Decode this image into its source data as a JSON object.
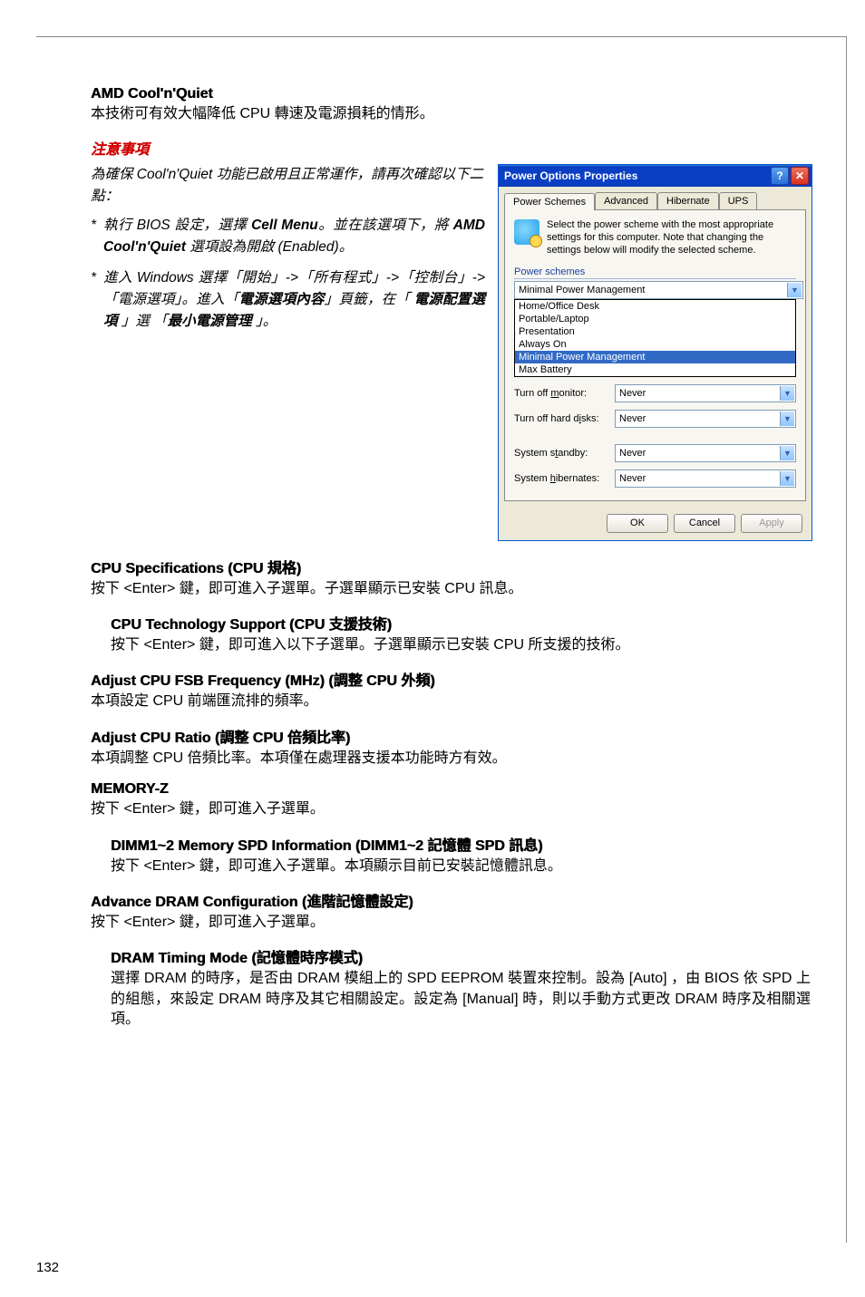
{
  "page_number": "132",
  "section_amd": {
    "title": "AMD Cool'n'Quiet",
    "body": "本技術可有效大幅降低 CPU 轉速及電源損耗的情形。"
  },
  "important": {
    "title": "注意事項",
    "intro": "為確保 Cool'n'Quiet 功能已啟用且正常運作，請再次確認以下二點：",
    "items": [
      {
        "pre": "執行 BIOS 設定，選擇 ",
        "em1": "Cell Menu",
        "mid1": "。並在該選項下，將 ",
        "em2": "AMD Cool'n'Quiet",
        "mid2": " 選項設為開啟 (Enabled)。"
      },
      {
        "pre": "進入  Windows  選擇「開始」->「所有程式」->「控制台」->「電源選項」。進入「",
        "em1": "電源選項內容",
        "mid1": "」頁籤，在「 ",
        "em2": "電源配置選項",
        "mid2": " 」選 「",
        "em3": "最小電源管理",
        "mid3": " 」。"
      }
    ]
  },
  "dialog": {
    "title": "Power Options Properties",
    "tabs": {
      "power_schemes": "Power Schemes",
      "advanced": "Advanced",
      "hibernate": "Hibernate",
      "ups": "UPS"
    },
    "info_text": "Select the power scheme with the most appropriate settings for this computer. Note that changing the settings below will modify the selected scheme.",
    "group_power_schemes": "Power schemes",
    "scheme_selected": "Minimal Power Management",
    "scheme_options": {
      "home_office": "Home/Office Desk",
      "portable": "Portable/Laptop",
      "presentation": "Presentation",
      "always_on": "Always On",
      "minimal": "Minimal Power Management",
      "max_battery": "Max Battery"
    },
    "settings": {
      "turn_off_monitor": {
        "label_pre": "Turn off ",
        "label_u": "m",
        "label_post": "onitor:",
        "value": "Never"
      },
      "turn_off_hard_disks": {
        "label_pre": "Turn off hard d",
        "label_u": "i",
        "label_post": "sks:",
        "value": "Never"
      },
      "system_standby": {
        "label_pre": "System s",
        "label_u": "t",
        "label_post": "andby:",
        "value": "Never"
      },
      "system_hibernates": {
        "label_pre": "System ",
        "label_u": "h",
        "label_post": "ibernates:",
        "value": "Never"
      }
    },
    "buttons": {
      "ok": "OK",
      "cancel": "Cancel",
      "apply": "Apply"
    }
  },
  "cpu_spec": {
    "title": "CPU Specifications (CPU 規格)",
    "body": "按下 <Enter> 鍵，即可進入子選單。子選單顯示已安裝 CPU 訊息。"
  },
  "cpu_tech": {
    "title": "CPU Technology Support (CPU 支援技術)",
    "body": "按下 <Enter> 鍵，即可進入以下子選單。子選單顯示已安裝 CPU 所支援的技術。"
  },
  "fsb": {
    "title": "Adjust CPU FSB Frequency (MHz) (調整 CPU 外頻)",
    "body": "本項設定 CPU 前端匯流排的頻率。"
  },
  "ratio": {
    "title": "Adjust CPU Ratio  (調整 CPU 倍頻比率)",
    "body": "本項調整 CPU 倍頻比率。本項僅在處理器支援本功能時方有效。"
  },
  "memz": {
    "title": "MEMORY-Z",
    "body": "按下 <Enter> 鍵，即可進入子選單。"
  },
  "dimm": {
    "title": "DIMM1~2 Memory SPD Information (DIMM1~2 記憶體 SPD 訊息)",
    "body": "按下 <Enter> 鍵，即可進入子選單。本項顯示目前已安裝記憶體訊息。"
  },
  "advdram": {
    "title": "Advance DRAM Configuration (進階記憶體設定)",
    "body": "按下 <Enter> 鍵，即可進入子選單。"
  },
  "dramtiming": {
    "title": "DRAM Timing Mode (記憶體時序模式)",
    "body": "選擇 DRAM 的時序，是否由 DRAM 模組上的 SPD EEPROM 裝置來控制。設為 [Auto] ，由 BIOS 依 SPD 上的組態，來設定 DRAM 時序及其它相關設定。設定為 [Manual] 時，則以手動方式更改 DRAM 時序及相關選項。"
  }
}
